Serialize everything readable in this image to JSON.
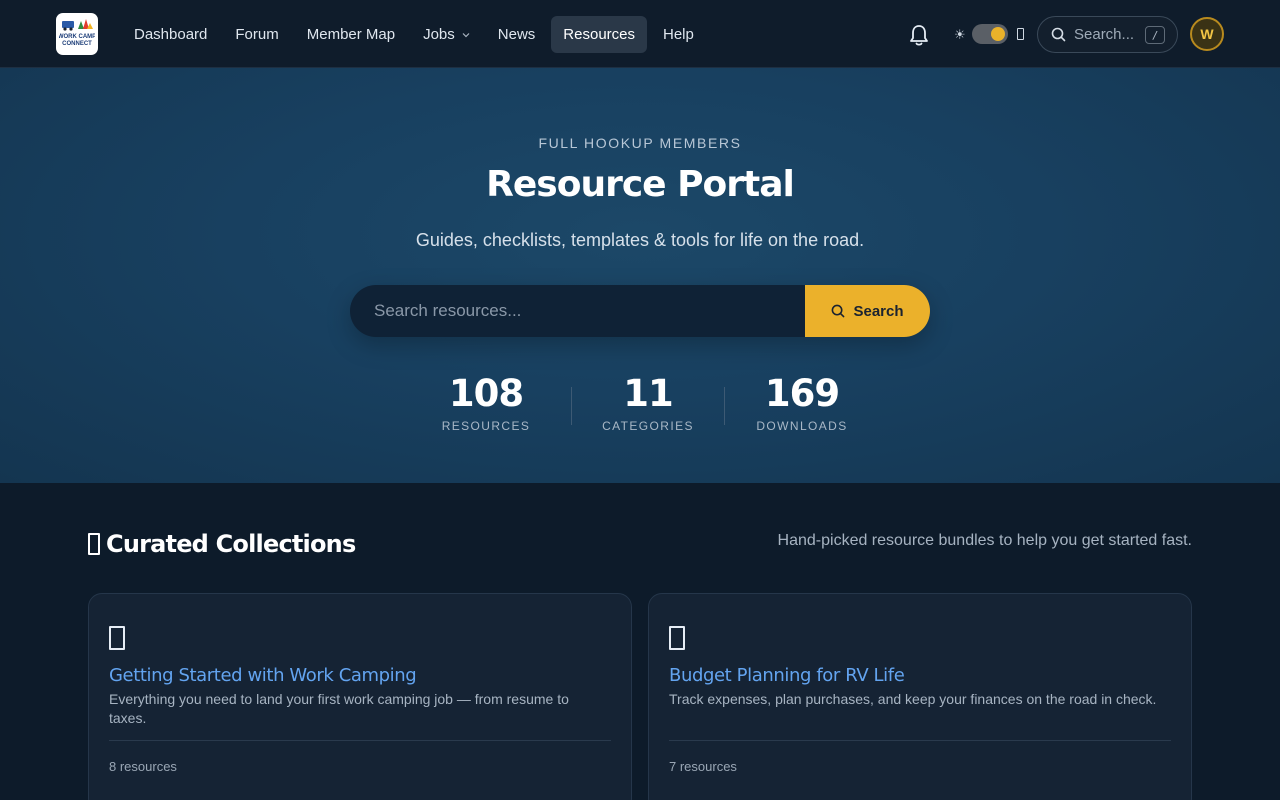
{
  "nav": {
    "logo_text": "WORK CAMP CONNECT",
    "links": [
      {
        "label": "Dashboard"
      },
      {
        "label": "Forum"
      },
      {
        "label": "Member Map"
      },
      {
        "label": "Jobs"
      },
      {
        "label": "News"
      },
      {
        "label": "Resources"
      },
      {
        "label": "Help"
      }
    ],
    "active_link": "Resources",
    "search_placeholder": "Search...",
    "search_shortcut": "/",
    "avatar_initial": "W",
    "icons": {
      "notifications": "bell-icon",
      "theme_light": "sun-icon",
      "theme_dark": "moon-icon",
      "search": "search-icon",
      "dropdown": "chevron-down-icon"
    }
  },
  "hero": {
    "eyebrow": "FULL HOOKUP MEMBERS",
    "title": "Resource Portal",
    "subtitle": "Guides, checklists, templates & tools for life on the road.",
    "search_placeholder": "Search resources...",
    "search_button": "Search",
    "stats": [
      {
        "value": "108",
        "label": "RESOURCES"
      },
      {
        "value": "11",
        "label": "CATEGORIES"
      },
      {
        "value": "169",
        "label": "DOWNLOADS"
      }
    ]
  },
  "collections": {
    "title": "Curated Collections",
    "note": "Hand-picked resource bundles to help you get started fast.",
    "cards": [
      {
        "title": "Getting Started with Work Camping",
        "description": "Everything you need to land your first work camping job — from resume to taxes.",
        "count": "8 resources"
      },
      {
        "title": "Budget Planning for RV Life",
        "description": "Track expenses, plan purchases, and keep your finances on the road in check.",
        "count": "7 resources"
      }
    ]
  },
  "colors": {
    "accent": "#ebb12b",
    "link": "#63a4f0",
    "background": "#0d1b2a",
    "hero": "#184060"
  }
}
